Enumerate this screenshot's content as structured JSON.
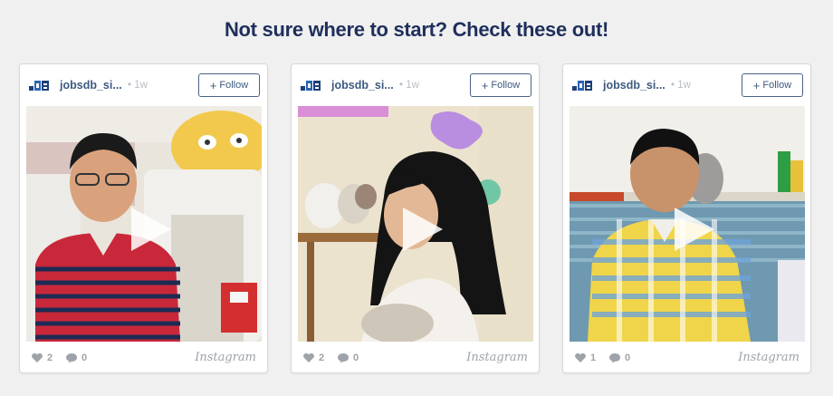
{
  "heading": "Not sure where to start? Check these out!",
  "colors": {
    "heading": "#1f2f5c",
    "username": "#3d5a80",
    "follow_border": "#4a6288",
    "muted": "#9ea3a9",
    "background": "#f0f0f0"
  },
  "cards": [
    {
      "username": "jobsdb_si...",
      "time": "• 1w",
      "follow_label": "Follow",
      "likes": "2",
      "comments": "0",
      "source": "Instagram",
      "logo_icon": "jobsdb-logo-icon",
      "play_icon": "play-icon"
    },
    {
      "username": "jobsdb_si...",
      "time": "• 1w",
      "follow_label": "Follow",
      "likes": "2",
      "comments": "0",
      "source": "Instagram",
      "logo_icon": "jobsdb-logo-icon",
      "play_icon": "play-icon"
    },
    {
      "username": "jobsdb_si...",
      "time": "• 1w",
      "follow_label": "Follow",
      "likes": "1",
      "comments": "0",
      "source": "Instagram",
      "logo_icon": "jobsdb-logo-icon",
      "play_icon": "play-icon"
    }
  ]
}
